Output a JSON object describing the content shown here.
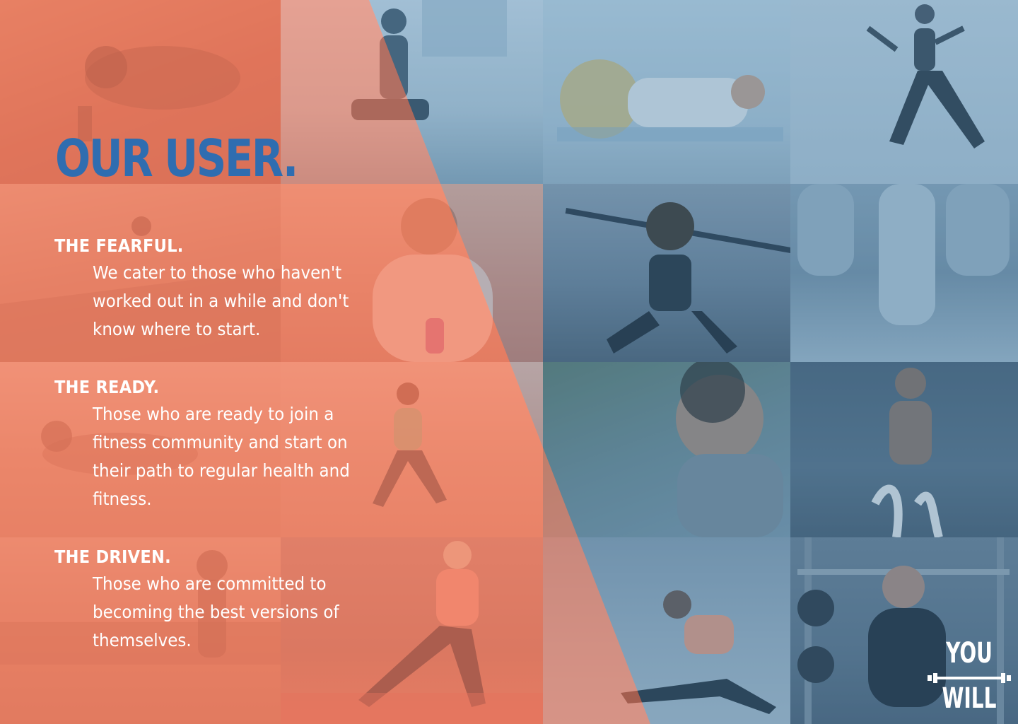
{
  "page": {
    "title": "OUR USER.",
    "colors": {
      "accent_title": "#2f6db0",
      "warm_overlay": "#f07a5e",
      "cool_overlay": "#3b7aa8",
      "text": "#ffffff"
    }
  },
  "segments": [
    {
      "heading": "THE FEARFUL.",
      "description": "We cater to those who haven't worked out in a while and don't know where to start."
    },
    {
      "heading": "THE READY.",
      "description": "Those who are ready to join a fitness community and start on their path to regular health and fitness."
    },
    {
      "heading": "THE DRIVEN.",
      "description": "Those who are committed to becoming the best versions of themselves."
    }
  ],
  "logo": {
    "top_word": "YOU",
    "bottom_word": "WILL",
    "icon": "dumbbell-icon"
  },
  "photos": [
    "push-up-photo",
    "lunge-photo",
    "stability-ball-crunch-photo",
    "jumping-athlete-photo",
    "runner-boardwalk-photo",
    "smiling-walker-photo",
    "barbell-squat-class-photo",
    "plank-feet-photo",
    "beach-push-up-photo",
    "beach-runner-photo",
    "outdoor-workout-man-photo",
    "battle-ropes-photo",
    "stretching-leg-photo",
    "gym-dumbbell-lunge-photo",
    "floor-stretch-photo",
    "pull-up-rack-photo"
  ]
}
